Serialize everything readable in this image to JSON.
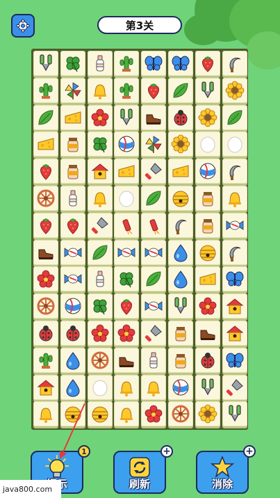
{
  "header": {
    "level_title": "第3关"
  },
  "icons": {
    "settings": "gear-icon"
  },
  "board": {
    "rows": 14,
    "cols": 8,
    "tiles": [
      [
        "pliers",
        "clover",
        "bottle",
        "cactus",
        "butterfly",
        "butterfly",
        "strawberry",
        "sickle"
      ],
      [
        "cactus",
        "pinwheel",
        "bell",
        "cactus",
        "strawberry",
        "leaf",
        "pliers",
        "sunflower"
      ],
      [
        "leaf",
        "cheese",
        "flower",
        "pliers",
        "shoe",
        "ladybug",
        "sunflower",
        "leaf"
      ],
      [
        "cheese",
        "jar",
        "clover",
        "ball",
        "pinwheel",
        "sunflower",
        "egg",
        "egg"
      ],
      [
        "strawberry",
        "jar",
        "birdhouse",
        "cheese",
        "trowel",
        "cheese",
        "ball",
        "sickle"
      ],
      [
        "wheel",
        "bottle",
        "bell",
        "egg",
        "leaf",
        "beehive",
        "jar",
        "bell"
      ],
      [
        "strawberry",
        "strawberry",
        "trowel",
        "firework",
        "firework",
        "sickle",
        "jar",
        "candy"
      ],
      [
        "shoe",
        "candy",
        "leaf",
        "candy",
        "candy",
        "drop",
        "beehive",
        "sickle"
      ],
      [
        "flower",
        "candy",
        "bottle",
        "clover",
        "leaf",
        "drop",
        "cheese",
        "butterfly"
      ],
      [
        "wheel",
        "ball",
        "clover",
        "strawberry",
        "candy",
        "pliers",
        "flower",
        "birdhouse"
      ],
      [
        "ladybug",
        "ladybug",
        "flower",
        "flower",
        "trowel",
        "jar",
        "shoe",
        "birdhouse"
      ],
      [
        "cactus",
        "drop",
        "wheel",
        "shoe",
        "bottle",
        "jar",
        "ladybug",
        "butterfly"
      ],
      [
        "birdhouse",
        "drop",
        "egg",
        "bell",
        "bell",
        "ball",
        "pliers",
        "trowel"
      ],
      [
        "bell",
        "beehive",
        "beehive",
        "bell",
        "flower",
        "wheel",
        "sunflower",
        "pliers"
      ]
    ]
  },
  "controls": {
    "hint": {
      "label": "提示",
      "count": "1"
    },
    "refresh": {
      "label": "刷新",
      "badge": "+"
    },
    "eliminate": {
      "label": "消除",
      "badge": "+"
    }
  },
  "watermark": "java800.com",
  "colors": {
    "background": "#6fd37a",
    "button": "#3ca0ee",
    "outline": "#1d2a5c",
    "hint_arrow": "#e23b3b"
  }
}
